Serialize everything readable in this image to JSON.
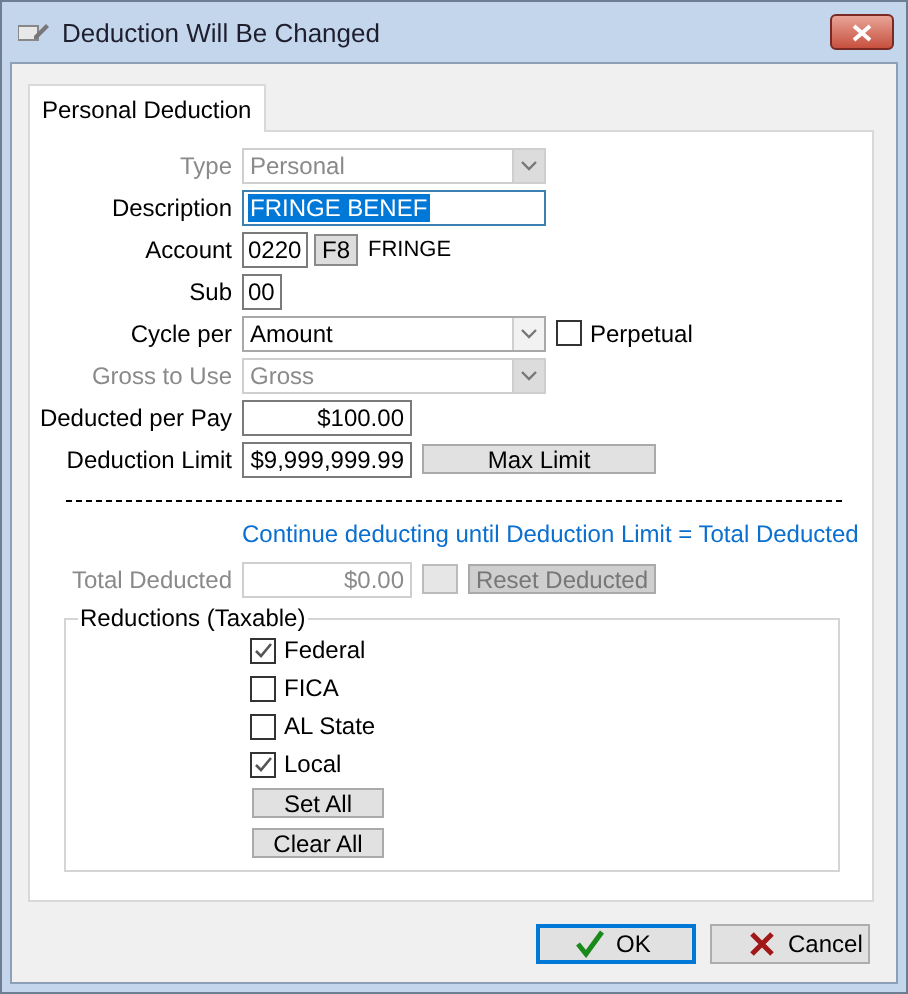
{
  "window": {
    "title": "Deduction Will Be Changed"
  },
  "tabs": [
    {
      "label": "Personal Deduction",
      "selected": true
    }
  ],
  "rows": [
    {
      "kind": "select",
      "label": "Type",
      "value": "Personal",
      "disabled": true
    },
    {
      "kind": "text",
      "label": "Description",
      "value": "FRINGE BENEF",
      "focused": true
    },
    {
      "kind": "account",
      "label": "Account",
      "value": "0220",
      "key_label": "F8",
      "account_name": "FRINGE"
    },
    {
      "kind": "short",
      "label": "Sub",
      "value": "00"
    },
    {
      "kind": "select",
      "label": "Cycle per",
      "value": "Amount",
      "disabled": false,
      "checkbox": {
        "label": "Perpetual",
        "checked": false
      }
    },
    {
      "kind": "select",
      "label": "Gross to Use",
      "value": "Gross",
      "disabled": true
    },
    {
      "kind": "amount",
      "label": "Deducted per Pay",
      "value": "$100.00"
    },
    {
      "kind": "amount",
      "label": "Deduction Limit",
      "value": "$9,999,999.99",
      "button": "Max Limit"
    }
  ],
  "note": "Continue deducting until Deduction Limit = Total Deducted",
  "total": {
    "label": "Total Deducted",
    "value": "$0.00",
    "disabled": true,
    "button": "Reset Deducted"
  },
  "reductions": {
    "title": "Reductions (Taxable)",
    "checks": [
      {
        "label": "Federal",
        "checked": true
      },
      {
        "label": "FICA",
        "checked": false
      },
      {
        "label": "AL State",
        "checked": false
      },
      {
        "label": "Local",
        "checked": true
      }
    ],
    "buttons": [
      "Set All",
      "Clear All"
    ]
  },
  "footer": [
    {
      "label": "OK",
      "kind": "confirm",
      "default": true
    },
    {
      "label": "Cancel",
      "kind": "cancel",
      "default": false
    }
  ]
}
